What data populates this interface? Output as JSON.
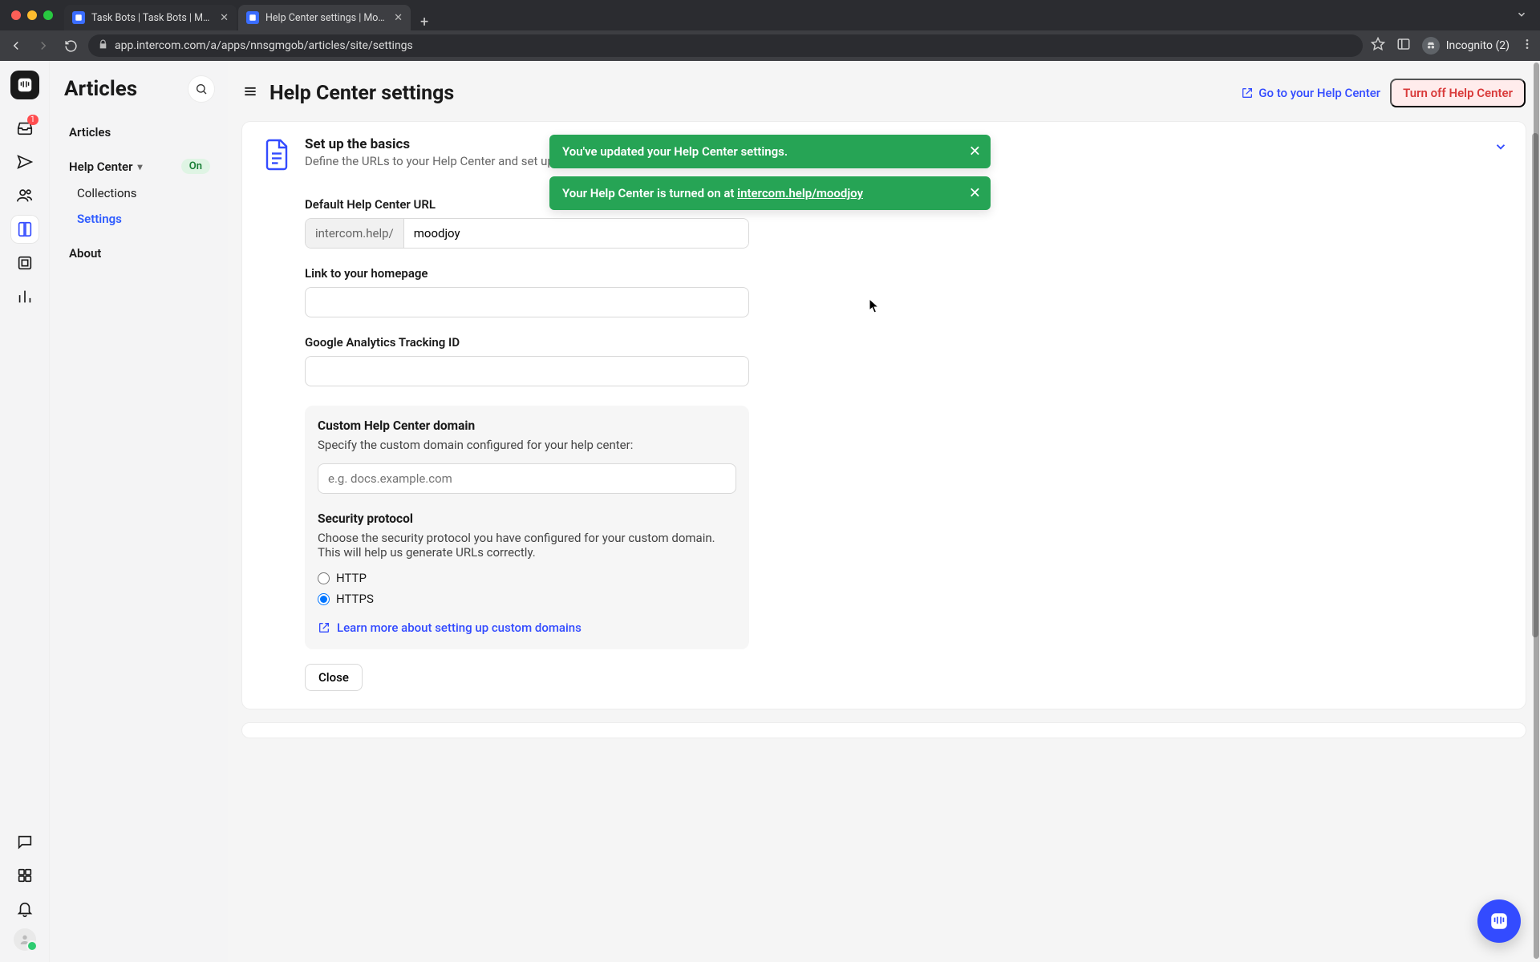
{
  "browser": {
    "tabs": [
      {
        "title": "Task Bots | Task Bots | Mood…"
      },
      {
        "title": "Help Center settings | Moodjo…"
      }
    ],
    "url": "app.intercom.com/a/apps/nnsgmgob/articles/site/settings",
    "incognito_label": "Incognito (2)"
  },
  "rail": {
    "inbox_badge": "1"
  },
  "sidebar": {
    "title": "Articles",
    "items": {
      "articles": "Articles",
      "help_center": "Help Center",
      "hc_status": "On",
      "collections": "Collections",
      "settings": "Settings",
      "about": "About"
    }
  },
  "header": {
    "page_title": "Help Center settings",
    "go_link": "Go to your Help Center",
    "turn_off": "Turn off Help Center"
  },
  "toasts": {
    "updated": "You've updated your Help Center settings.",
    "on_prefix": "Your Help Center is turned on at ",
    "on_link": "intercom.help/moodjoy"
  },
  "section": {
    "title": "Set up the basics",
    "subtitle": "Define the URLs to your Help Center and set up your analytics tracking"
  },
  "form": {
    "default_url_label": "Default Help Center URL",
    "url_prefix": "intercom.help/",
    "url_value": "moodjoy",
    "homepage_label": "Link to your homepage",
    "homepage_value": "",
    "ga_label": "Google Analytics Tracking ID",
    "ga_value": ""
  },
  "custom_domain": {
    "title": "Custom Help Center domain",
    "desc": "Specify the custom domain configured for your help center:",
    "placeholder": "e.g. docs.example.com",
    "value": "",
    "security_title": "Security protocol",
    "security_desc": "Choose the security protocol you have configured for your custom domain. This will help us generate URLs correctly.",
    "http_label": "HTTP",
    "https_label": "HTTPS",
    "learn_link": "Learn more about setting up custom domains"
  },
  "actions": {
    "close": "Close"
  }
}
